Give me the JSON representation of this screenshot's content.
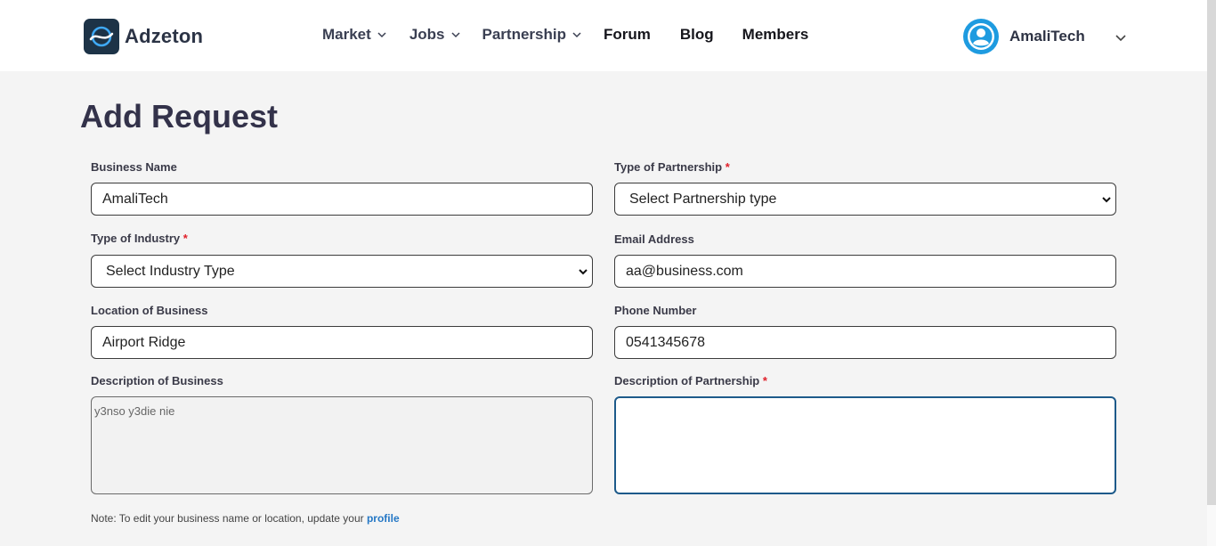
{
  "brand": {
    "name": "Adzeton",
    "logo_icon": "adzeton-logo-icon"
  },
  "nav": {
    "items": [
      {
        "label": "Market",
        "dropdown": true
      },
      {
        "label": "Jobs",
        "dropdown": true
      },
      {
        "label": "Partnership",
        "dropdown": true
      },
      {
        "label": "Forum",
        "dropdown": false
      },
      {
        "label": "Blog",
        "dropdown": false
      },
      {
        "label": "Members",
        "dropdown": false
      }
    ]
  },
  "user": {
    "name": "AmaliTech",
    "avatar_icon": "user-avatar-icon"
  },
  "page": {
    "title": "Add Request"
  },
  "form": {
    "business_name": {
      "label": "Business Name",
      "value": "AmaliTech"
    },
    "partnership_type": {
      "label": "Type of Partnership",
      "required_mark": "*",
      "value": "Select Partnership type"
    },
    "industry_type": {
      "label": "Type of Industry",
      "required_mark": "*",
      "value": "Select Industry Type"
    },
    "email": {
      "label": "Email Address",
      "value": "aa@business.com"
    },
    "location": {
      "label": "Location of Business",
      "value": "Airport Ridge"
    },
    "phone": {
      "label": "Phone Number",
      "value": "0541345678"
    },
    "business_description": {
      "label": "Description of Business",
      "value": "y3nso y3die nie"
    },
    "partnership_description": {
      "label": "Description of Partnership",
      "required_mark": "*",
      "value": ""
    }
  },
  "note": {
    "text": "Note: To edit your business name or location, update your ",
    "link": "profile"
  },
  "colors": {
    "accent": "#1e9be0",
    "link": "#2477c5",
    "focus_border": "#1d5a8a",
    "required": "#e0202a",
    "background": "#f4f4f4"
  }
}
